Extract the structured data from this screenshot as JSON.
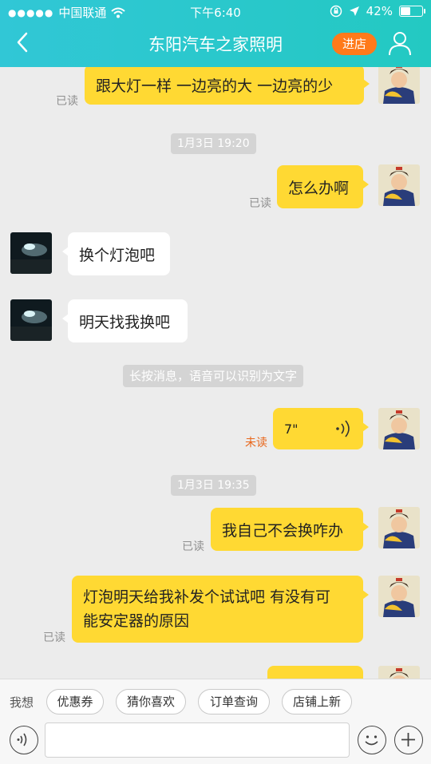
{
  "status": {
    "carrier": "中国联通",
    "time": "下午6:40",
    "battery": "42%"
  },
  "nav": {
    "title": "东阳汽车之家照明",
    "shop_label": "进店"
  },
  "messages": [
    {
      "text": "跟大灯一样 一边亮的大 一边亮的少",
      "status": "已读"
    },
    {
      "time": "1月3日 19:20"
    },
    {
      "text": "怎么办啊",
      "status": "已读"
    },
    {
      "text": "换个灯泡吧"
    },
    {
      "text": "明天找我换吧"
    },
    {
      "hint": "长按消息，语音可以识别为文字"
    },
    {
      "voice_duration": "7\"",
      "status": "未读"
    },
    {
      "time": "1月3日 19:35"
    },
    {
      "text": "我自己不会换咋办",
      "status": "已读"
    },
    {
      "text_line1": "灯泡明天给我补发个试试吧 有没有可",
      "text_line2": "能安定器的原因",
      "status": "已读"
    }
  ],
  "bottom": {
    "want_label": "我想",
    "chips": [
      "优惠券",
      "猜你喜欢",
      "订单查询",
      "店铺上新"
    ]
  },
  "colors": {
    "accent": "#23c9c2",
    "bubble_me": "#ffd933",
    "shop_btn": "#ff7a1a",
    "unread": "#e8661a"
  },
  "icons": [
    "back-icon",
    "user-icon",
    "wifi-icon",
    "lock-rotation-icon",
    "location-arrow-icon",
    "battery-icon",
    "voice-wave-icon",
    "voice-mode-icon",
    "emoji-icon",
    "plus-icon"
  ]
}
